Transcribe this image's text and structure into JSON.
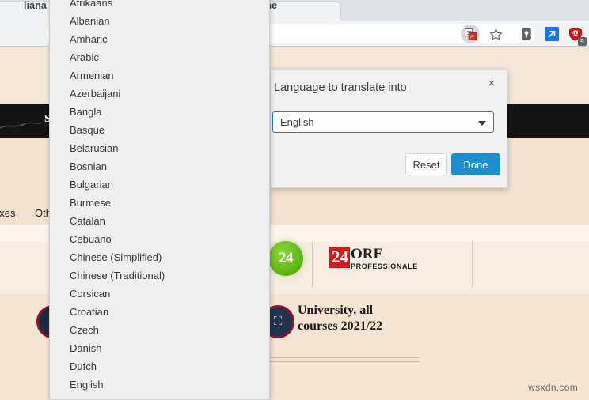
{
  "browser": {
    "tab_title_left": "liana ed",
    "tab_title_right": "me",
    "toolbar_icons": [
      {
        "name": "translate-icon",
        "glyph": "翻"
      },
      {
        "name": "bookmark-star-icon",
        "glyph": "☆"
      },
      {
        "name": "password-manager-icon",
        "glyph": "⚿"
      },
      {
        "name": "open-external-icon",
        "glyph": "↗"
      },
      {
        "name": "adblock-shield-icon",
        "glyph": "⛨"
      }
    ],
    "adblock_badge_count": "9"
  },
  "translate_popup": {
    "title": "Language to translate into",
    "close_label": "×",
    "selected_language": "English",
    "reset_label": "Reset",
    "done_label": "Done",
    "accent_color": "#1e8fce",
    "select_border_color": "#2f7f9e"
  },
  "language_dropdown": {
    "items": [
      "Afrikaans",
      "Albanian",
      "Amharic",
      "Arabic",
      "Armenian",
      "Azerbaijani",
      "Bangla",
      "Basque",
      "Belarusian",
      "Bosnian",
      "Bulgarian",
      "Burmese",
      "Catalan",
      "Cebuano",
      "Chinese (Simplified)",
      "Chinese (Traditional)",
      "Corsican",
      "Croatian",
      "Czech",
      "Danish",
      "Dutch",
      "English"
    ],
    "selected": "English"
  },
  "page": {
    "dark_band_text": "Spread",
    "nav_items": [
      "axes",
      "Oth"
    ],
    "green_badge_text": "24",
    "ore_logo": {
      "red_part": "24",
      "word": "ORE",
      "subtitle": "PROFESSIONALE"
    },
    "university_card": {
      "title_line1": "University, all",
      "title_line2": "courses 2021/22"
    },
    "watermark": "wsxdn.com"
  }
}
